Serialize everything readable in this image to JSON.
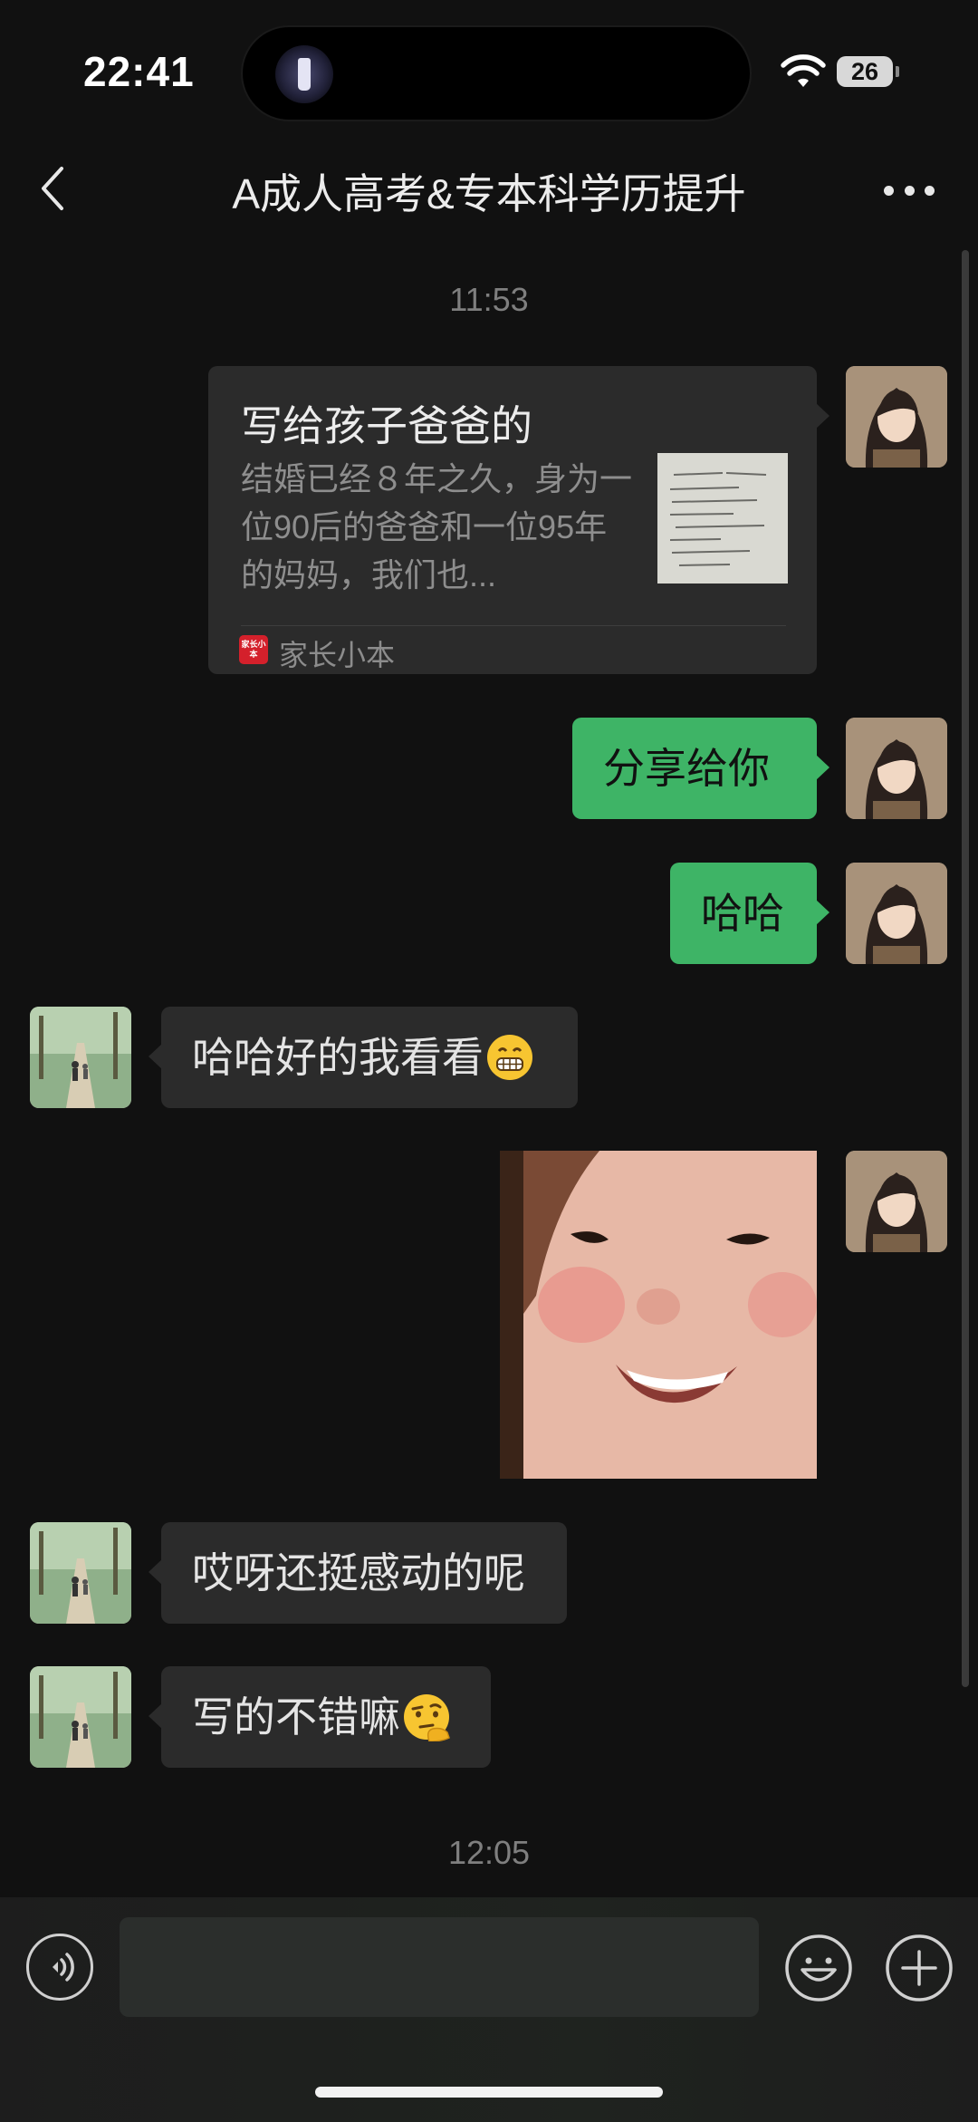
{
  "status_bar": {
    "time": "22:41",
    "battery": "26"
  },
  "nav": {
    "title": "A成人高考&专本科学历提升"
  },
  "timestamps": [
    "11:53",
    "12:05"
  ],
  "share_card": {
    "title": "写给孩子爸爸的",
    "description": "结婚已经８年之久，身为一位90后的爸爸和一位95年的妈妈，我们也...",
    "source_icon_text": "家长小本",
    "source": "家长小本"
  },
  "messages": {
    "m1": "分享给你",
    "m2": "哈哈",
    "m3": "哈哈好的我看看",
    "m5": "哎呀还挺感动的呢",
    "m6": "写的不错嘛"
  },
  "icons": {
    "back": "chevron-left-icon",
    "more": "more-icon",
    "voice": "voice-icon",
    "emoji": "smiley-icon",
    "plus": "plus-icon"
  },
  "colors": {
    "background": "#111111",
    "self_bubble": "#3eb466",
    "other_bubble": "#2b2b2b",
    "card_source_icon": "#d4202b"
  }
}
